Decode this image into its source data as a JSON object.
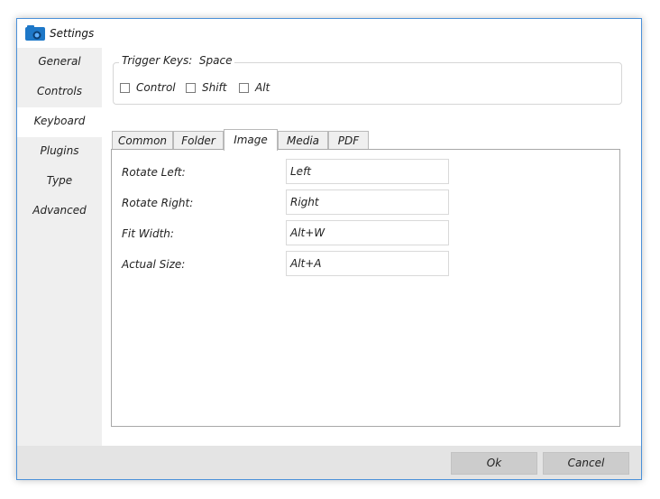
{
  "window": {
    "title": "Settings",
    "icon": "camera-app-icon",
    "accent_color": "#4a90d9"
  },
  "sidebar": {
    "items": [
      {
        "label": "General"
      },
      {
        "label": "Controls"
      },
      {
        "label": "Keyboard",
        "active": true
      },
      {
        "label": "Plugins"
      },
      {
        "label": "Type"
      },
      {
        "label": "Advanced"
      }
    ]
  },
  "trigger": {
    "legend": "Trigger Keys:",
    "value": "Space",
    "options": [
      {
        "label": "Control",
        "checked": false
      },
      {
        "label": "Shift",
        "checked": false
      },
      {
        "label": "Alt",
        "checked": false
      }
    ]
  },
  "tabs": [
    {
      "label": "Common"
    },
    {
      "label": "Folder"
    },
    {
      "label": "Image",
      "active": true
    },
    {
      "label": "Media"
    },
    {
      "label": "PDF"
    }
  ],
  "image_shortcuts": [
    {
      "label": "Rotate Left:",
      "value": "Left"
    },
    {
      "label": "Rotate Right:",
      "value": "Right"
    },
    {
      "label": "Fit Width:",
      "value": "Alt+W"
    },
    {
      "label": "Actual Size:",
      "value": "Alt+A"
    }
  ],
  "footer": {
    "ok_label": "Ok",
    "cancel_label": "Cancel"
  }
}
